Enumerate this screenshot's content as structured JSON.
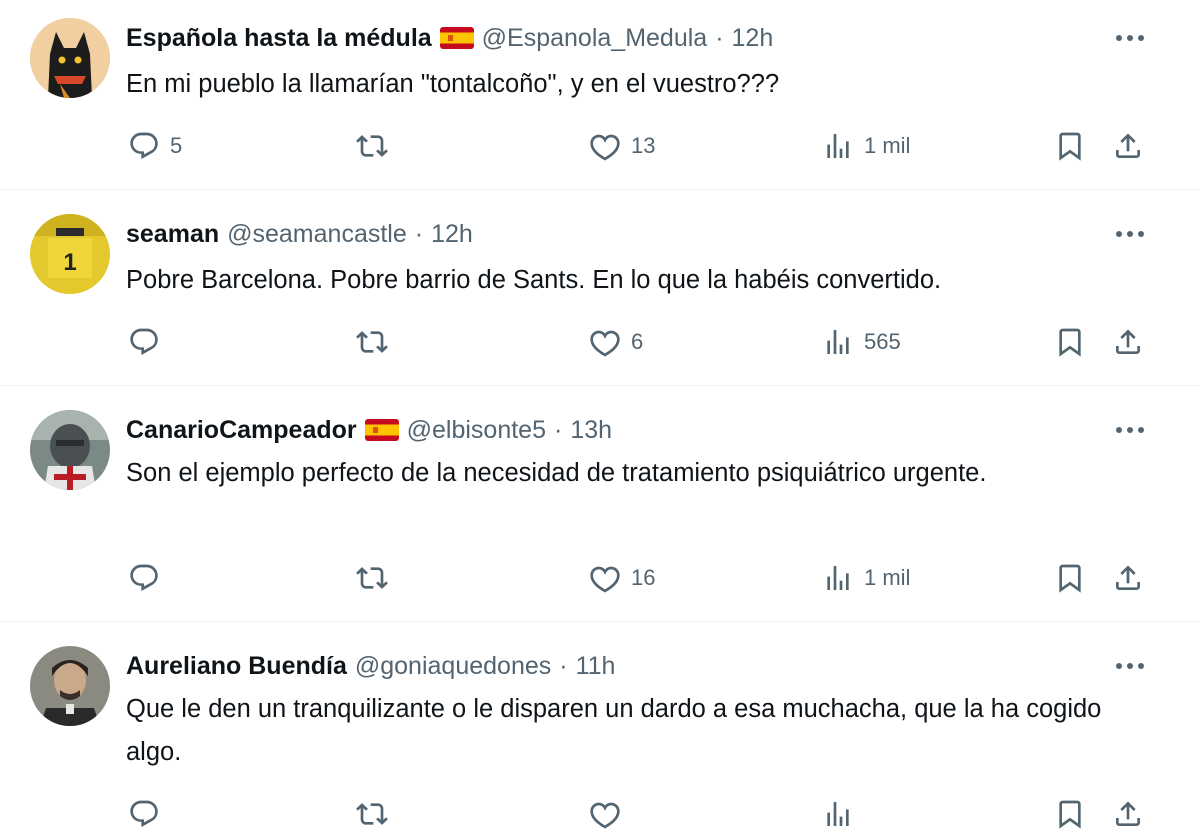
{
  "tweets": [
    {
      "name": "Española hasta la médula",
      "handle": "@Espanola_Medula",
      "dot": "·",
      "time": "12h",
      "has_flag": true,
      "text": "En mi pueblo la llamarían \"tontalcoño\", y en el vuestro???",
      "replies": "5",
      "retweets": "",
      "likes": "13",
      "views": "1 mil",
      "avatar_icon": "black-cat-avatar"
    },
    {
      "name": "seaman",
      "handle": "@seamancastle",
      "dot": "·",
      "time": "12h",
      "has_flag": false,
      "text": "Pobre Barcelona. Pobre barrio de Sants. En lo que la habéis convertido.",
      "replies": "",
      "retweets": "",
      "likes": "6",
      "views": "565",
      "avatar_icon": "yellow-jersey-avatar"
    },
    {
      "name": "CanarioCampeador",
      "handle": "@elbisonte5",
      "dot": "·",
      "time": "13h",
      "has_flag": true,
      "text": "Son el ejemplo perfecto de la necesidad de tratamiento psiquiátrico urgente.",
      "replies": "",
      "retweets": "",
      "likes": "16",
      "views": "1 mil",
      "avatar_icon": "knight-helmet-avatar"
    },
    {
      "name": "Aureliano Buendía",
      "handle": "@goniaquedones",
      "dot": "·",
      "time": "11h",
      "has_flag": false,
      "text": "Que le den un tranquilizante o le disparen un dardo a esa muchacha, que la ha cogido algo.",
      "replies": "",
      "retweets": "",
      "likes": "",
      "views": "",
      "avatar_icon": "man-portrait-avatar"
    }
  ],
  "colors": {
    "text": "#0f1419",
    "secondary": "#536471",
    "divider": "#eff3f4",
    "flag_red": "#c60b1e",
    "flag_yellow": "#ffc400"
  }
}
